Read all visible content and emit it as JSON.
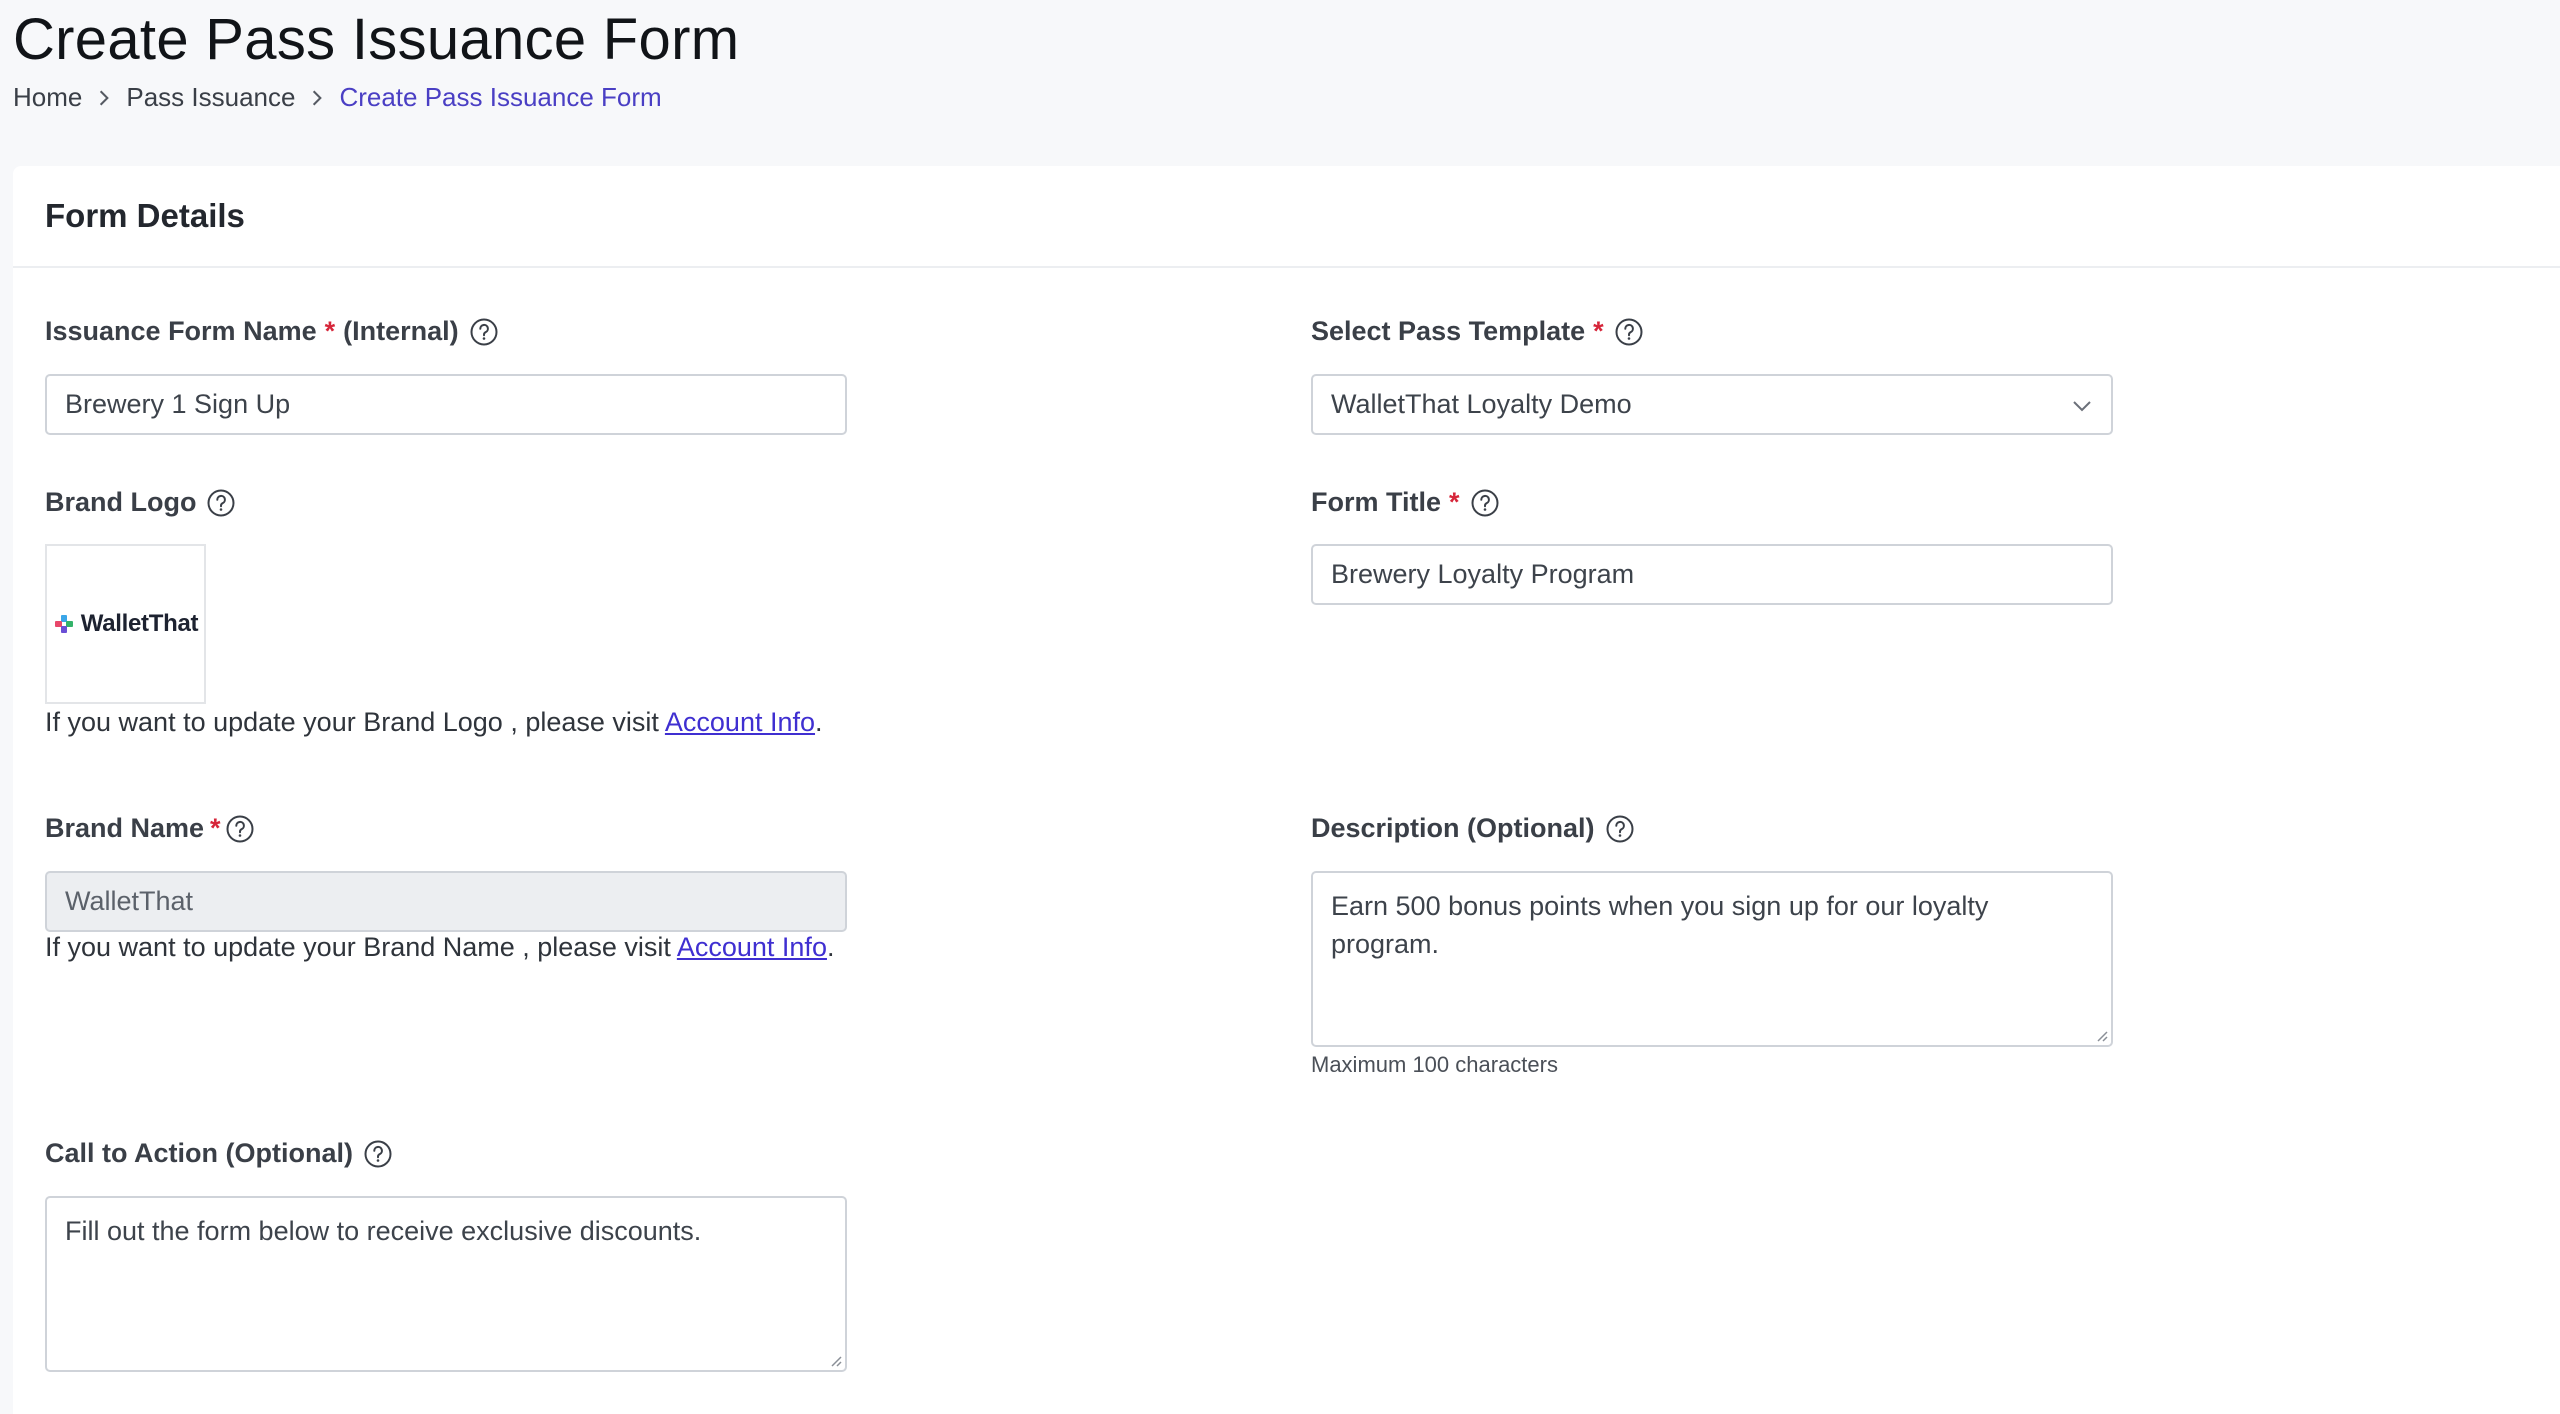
{
  "page": {
    "title": "Create Pass Issuance Form",
    "breadcrumb": [
      "Home",
      "Pass Issuance",
      "Create Pass Issuance Form"
    ]
  },
  "card": {
    "title": "Form Details"
  },
  "fields": {
    "issuance_name": {
      "label": "Issuance Form Name",
      "required": "*",
      "suffix": "(Internal)",
      "value": "Brewery 1 Sign Up"
    },
    "pass_template": {
      "label": "Select Pass Template",
      "required": "*",
      "value": "WalletThat Loyalty Demo"
    },
    "brand_logo": {
      "label": "Brand Logo",
      "logo_text": "WalletThat",
      "helper_prefix": "If you want to update your Brand Logo , please visit ",
      "helper_link": "Account Info",
      "helper_suffix": "."
    },
    "form_title": {
      "label": "Form Title",
      "required": "*",
      "value": "Brewery Loyalty Program"
    },
    "brand_name": {
      "label": "Brand Name",
      "required": "*",
      "value": "WalletThat",
      "helper_prefix": "If you want to update your Brand Name , please visit ",
      "helper_link": "Account Info",
      "helper_suffix": "."
    },
    "description": {
      "label": "Description (Optional)",
      "value": "Earn 500 bonus points when you sign up for our loyalty program.",
      "note": "Maximum 100 characters"
    },
    "cta": {
      "label": "Call to Action (Optional)",
      "value": "Fill out the form below to receive exclusive discounts."
    }
  },
  "colors": {
    "accent": "#4a3fc4",
    "link": "#3f2fd1",
    "required": "#d6263a",
    "background": "#f7f8fa"
  }
}
